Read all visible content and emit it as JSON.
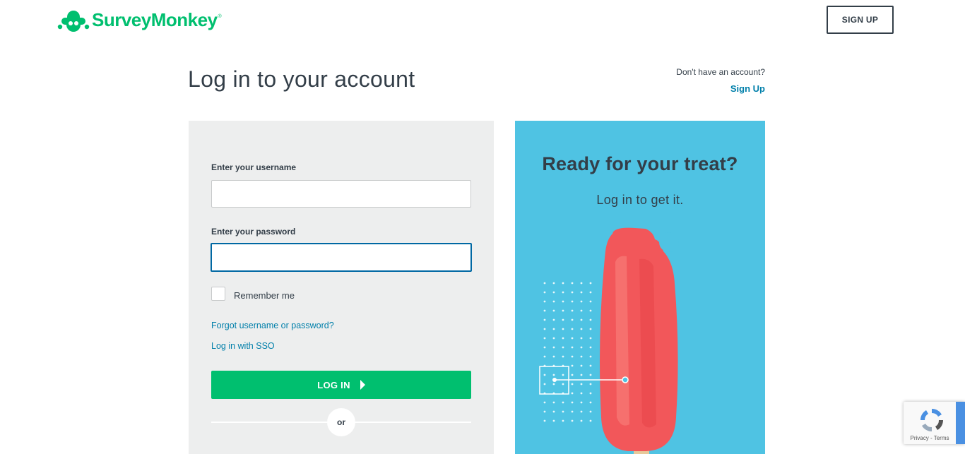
{
  "header": {
    "brand_name": "SurveyMonkey",
    "brand_reg": "®",
    "signup_button": "SIGN UP"
  },
  "page": {
    "title": "Log in to your account",
    "no_account_text": "Don't have an account?",
    "signup_link": "Sign Up"
  },
  "login_form": {
    "username_label": "Enter your username",
    "username_value": "",
    "password_label": "Enter your password",
    "password_value": "",
    "remember_label": "Remember me",
    "forgot_link": "Forgot username or password?",
    "sso_link": "Log in with SSO",
    "login_button": "LOG IN",
    "or_text": "or"
  },
  "promo": {
    "title": "Ready for your treat?",
    "subtitle": "Log in to get it."
  },
  "recaptcha": {
    "text": "Privacy - Terms"
  },
  "colors": {
    "brand_green": "#00bf6f",
    "link_blue": "#007faa",
    "focus_blue": "#0068a3",
    "promo_bg": "#4fc3e3",
    "popsicle_red": "#f2575a"
  },
  "icons": {
    "logo": "surveymonkey-logo-icon",
    "login_arrow": "caret-right-icon",
    "recaptcha": "recaptcha-icon"
  }
}
